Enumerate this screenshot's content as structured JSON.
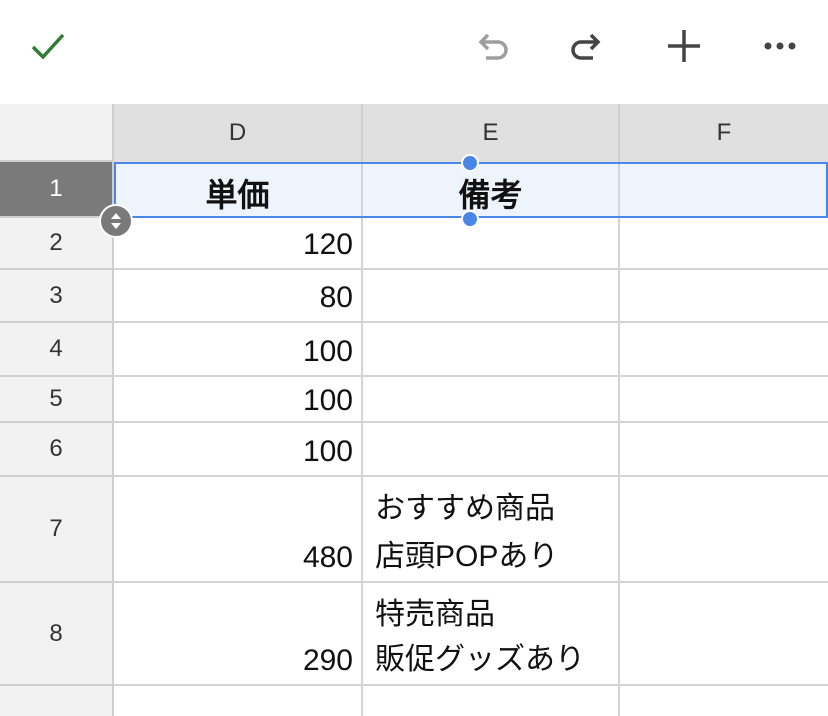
{
  "toolbar": {
    "icons": [
      "check-icon",
      "undo-icon",
      "redo-icon",
      "add-icon",
      "more-icon"
    ],
    "colors": {
      "check": "#2e7d32",
      "undo_disabled": "#9e9e9e",
      "active": "#444444"
    }
  },
  "columns": [
    "D",
    "E",
    "F"
  ],
  "rows": [
    {
      "num": "1",
      "d": "単価",
      "e1": "備考",
      "e2": ""
    },
    {
      "num": "2",
      "d": "120",
      "e1": "",
      "e2": ""
    },
    {
      "num": "3",
      "d": "80",
      "e1": "",
      "e2": ""
    },
    {
      "num": "4",
      "d": "100",
      "e1": "",
      "e2": ""
    },
    {
      "num": "5",
      "d": "100",
      "e1": "",
      "e2": ""
    },
    {
      "num": "6",
      "d": "100",
      "e1": "",
      "e2": ""
    },
    {
      "num": "7",
      "d": "480",
      "e1": "おすすめ商品",
      "e2": "店頭POPあり"
    },
    {
      "num": "8",
      "d": "290",
      "e1": "特売商品",
      "e2": "販促グッズあり"
    }
  ],
  "selection": {
    "row": "1",
    "color": "#4a86e8"
  }
}
